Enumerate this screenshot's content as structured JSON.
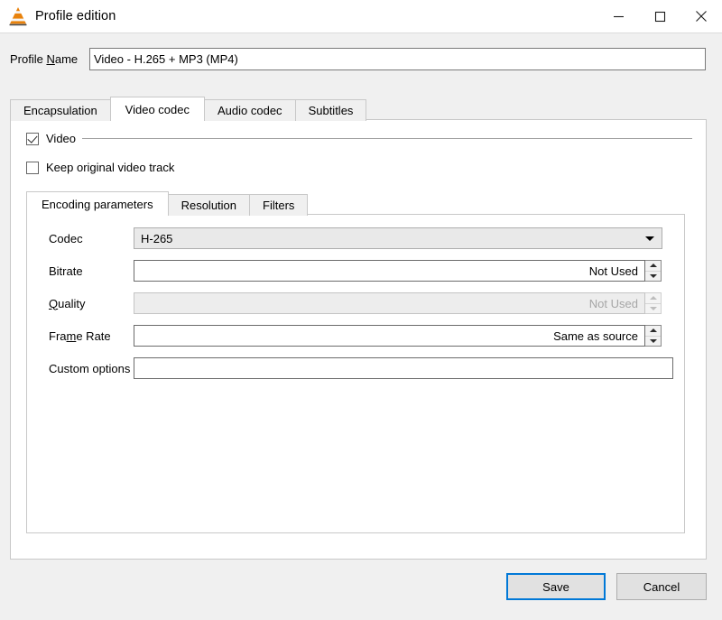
{
  "window": {
    "title": "Profile edition",
    "icon": "vlc-cone-icon",
    "controls": {
      "minimize": "minimize-icon",
      "maximize": "maximize-icon",
      "close": "close-icon"
    }
  },
  "profile": {
    "label_before": "Profile ",
    "label_mnemonic": "N",
    "label_after": "ame",
    "value": "Video - H.265 + MP3 (MP4)"
  },
  "tabs": [
    {
      "label": "Encapsulation",
      "active": false
    },
    {
      "label": "Video codec",
      "active": true
    },
    {
      "label": "Audio codec",
      "active": false
    },
    {
      "label": "Subtitles",
      "active": false
    }
  ],
  "checkboxes": [
    {
      "label": "Video",
      "checked": true
    },
    {
      "label": "Keep original video track",
      "checked": false
    }
  ],
  "inner_tabs": [
    {
      "label": "Encoding parameters",
      "active": true
    },
    {
      "label": "Resolution",
      "active": false
    },
    {
      "label": "Filters",
      "active": false
    }
  ],
  "form": {
    "codec": {
      "label": "Codec",
      "value": "H-265"
    },
    "bitrate": {
      "label": "Bitrate",
      "value": "Not Used",
      "disabled": false
    },
    "quality": {
      "label_mnemonic": "Q",
      "label_after": "uality",
      "value": "Not Used",
      "disabled": true
    },
    "frame_rate": {
      "label_before": "Fra",
      "label_mnemonic": "m",
      "label_after": "e Rate",
      "value": "Same as source",
      "disabled": false
    },
    "custom_options": {
      "label": "Custom options",
      "value": ""
    }
  },
  "footer": {
    "save": "Save",
    "cancel": "Cancel"
  },
  "colors": {
    "accent": "#0078d7",
    "window_bg": "#f0f0f0",
    "panel_bg": "#ffffff",
    "disabled_text": "#a6a6a6"
  }
}
